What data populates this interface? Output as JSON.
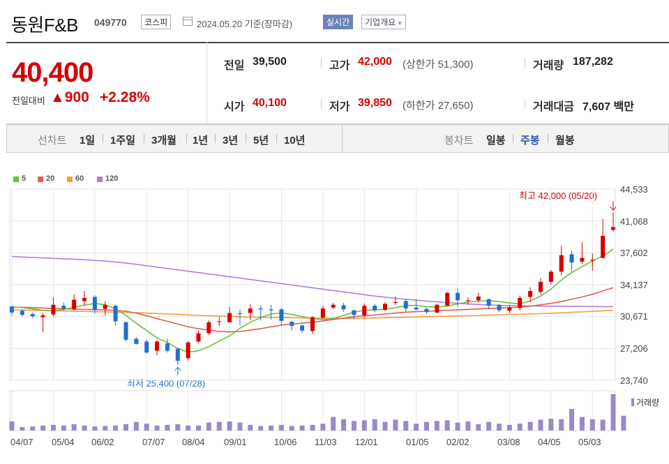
{
  "header": {
    "company": "동원F&B",
    "code": "049770",
    "market": "코스피",
    "date": "2024.05.20  기준(장마감)",
    "realtime": "실시간",
    "overview": "기업개요"
  },
  "quote": {
    "price": "40,400",
    "change_label": "전일대비",
    "change_value": "▲900",
    "change_pct": "+2.28%",
    "prev_label": "전일",
    "prev": "39,500",
    "open_label": "시가",
    "open": "40,100",
    "high_label": "고가",
    "high": "42,000",
    "upper_limit": "(상한가 51,300)",
    "low_label": "저가",
    "low": "39,850",
    "lower_limit": "(하한가 27,650)",
    "volume_label": "거래량",
    "volume": "187,282",
    "amount_label": "거래대금",
    "amount": "7,607 백만"
  },
  "tabs": {
    "line_header": "선차트",
    "line": [
      "1일",
      "1주일",
      "3개월",
      "1년",
      "3년",
      "5년",
      "10년"
    ],
    "candle_header": "봉차트",
    "candle": [
      "일봉",
      "주봉",
      "월봉"
    ],
    "selected": "주봉"
  },
  "colors": {
    "up": "#d60000",
    "down": "#1f6fd1",
    "ma5": "#6bbf3a",
    "ma20": "#e85a4f",
    "ma60": "#f39c3c",
    "ma120": "#b07fd6",
    "volume": "#9b88c9",
    "grid": "#e6e6e6"
  },
  "chart_data": {
    "type": "candlestick",
    "legend": [
      {
        "name": "5",
        "color": "#6bbf3a"
      },
      {
        "name": "20",
        "color": "#e85a4f"
      },
      {
        "name": "60",
        "color": "#f39c3c"
      },
      {
        "name": "120",
        "color": "#b07fd6"
      }
    ],
    "y_ticks": [
      "44,533",
      "41,068",
      "37,602",
      "34,137",
      "30,671",
      "27,206",
      "23,740"
    ],
    "ylim": [
      23740,
      44533
    ],
    "x_ticks": [
      "04/07",
      "05/04",
      "06/02",
      "07/07",
      "08/04",
      "09/01",
      "10/06",
      "11/03",
      "12/01",
      "01/05",
      "02/02",
      "03/08",
      "04/05",
      "05/03"
    ],
    "x_tick_index": [
      0,
      4,
      8,
      13,
      17,
      21,
      26,
      30,
      34,
      39,
      43,
      48,
      52,
      56
    ],
    "annotations": {
      "max": "최고 42,000 (05/20)",
      "min": "최저 25,400 (07/28)"
    },
    "volume_label": "거래량",
    "candles": [
      [
        31750,
        31100,
        31900,
        30800
      ],
      [
        31300,
        30850,
        31450,
        30700
      ],
      [
        30950,
        30700,
        31100,
        30500
      ],
      [
        30600,
        30800,
        31050,
        28950
      ],
      [
        30900,
        31950,
        32750,
        30700
      ],
      [
        31850,
        31500,
        32200,
        31300
      ],
      [
        31450,
        32500,
        33100,
        31300
      ],
      [
        32350,
        32700,
        33450,
        31850
      ],
      [
        32800,
        31400,
        33000,
        31000
      ],
      [
        31500,
        31950,
        32350,
        30750
      ],
      [
        31850,
        30150,
        31950,
        29650
      ],
      [
        30050,
        28150,
        30150,
        27950
      ],
      [
        28250,
        27700,
        28450,
        27600
      ],
      [
        27950,
        26750,
        28150,
        26650
      ],
      [
        26950,
        27950,
        28150,
        26450
      ],
      [
        27750,
        26950,
        28250,
        26750
      ],
      [
        27150,
        25850,
        27300,
        25400
      ],
      [
        26150,
        27850,
        28000,
        25900
      ],
      [
        27950,
        28850,
        29150,
        27800
      ],
      [
        28850,
        30050,
        30250,
        28650
      ],
      [
        30150,
        30150,
        30650,
        29650
      ],
      [
        30050,
        31050,
        31750,
        30750
      ],
      [
        31050,
        30950,
        31450,
        29750
      ],
      [
        31050,
        31550,
        32050,
        30250
      ],
      [
        31550,
        31450,
        31850,
        30250
      ],
      [
        31450,
        31350,
        31950,
        30350
      ],
      [
        31450,
        30200,
        31600,
        29800
      ],
      [
        30100,
        29650,
        30200,
        29150
      ],
      [
        29700,
        29150,
        29800,
        28900
      ],
      [
        29100,
        30600,
        30700,
        28800
      ],
      [
        30550,
        31550,
        31850,
        30450
      ],
      [
        31650,
        31950,
        32150,
        31450
      ],
      [
        31900,
        31450,
        32150,
        31150
      ],
      [
        31350,
        30850,
        31400,
        30350
      ],
      [
        30800,
        31850,
        32100,
        30550
      ],
      [
        31850,
        31350,
        32050,
        31100
      ],
      [
        31400,
        32050,
        32250,
        31250
      ],
      [
        32150,
        32250,
        32850,
        31950
      ],
      [
        32350,
        31550,
        32550,
        31150
      ],
      [
        31650,
        31450,
        32550,
        31350
      ],
      [
        31500,
        31150,
        31650,
        30950
      ],
      [
        31100,
        31950,
        32050,
        31050
      ],
      [
        31850,
        33250,
        33350,
        31850
      ],
      [
        33250,
        32450,
        33750,
        31750
      ],
      [
        32450,
        32450,
        32750,
        31950
      ],
      [
        32450,
        32850,
        33250,
        32200
      ],
      [
        32550,
        31850,
        32650,
        31450
      ],
      [
        31950,
        31350,
        32050,
        31150
      ],
      [
        31300,
        31650,
        31950,
        31050
      ],
      [
        31600,
        32700,
        32950,
        31350
      ],
      [
        32800,
        33450,
        33850,
        32250
      ],
      [
        33350,
        34450,
        34850,
        33050
      ],
      [
        34450,
        35550,
        35750,
        34150
      ],
      [
        35550,
        37350,
        38350,
        35150
      ],
      [
        37450,
        36550,
        37850,
        35550
      ],
      [
        36650,
        37050,
        38750,
        36350
      ],
      [
        36750,
        36850,
        37550,
        35650
      ],
      [
        37050,
        39450,
        41300,
        37000
      ],
      [
        40100,
        40400,
        42000,
        39850
      ]
    ],
    "ma5": [
      31700,
      31650,
      31500,
      31350,
      31300,
      31450,
      31700,
      31900,
      32100,
      31950,
      31500,
      30800,
      29950,
      29150,
      28350,
      27850,
      27200,
      26800,
      26950,
      27400,
      28000,
      28550,
      29400,
      30050,
      30550,
      30950,
      31050,
      30900,
      30650,
      30450,
      30350,
      30450,
      30800,
      31150,
      31350,
      31400,
      31450,
      31650,
      31850,
      31900,
      31750,
      31700,
      31800,
      32050,
      32250,
      32350,
      32400,
      32300,
      32150,
      32050,
      32350,
      32900,
      33650,
      34650,
      35450,
      36100,
      36700,
      37250,
      38000
    ],
    "ma20": [
      31700,
      31680,
      31650,
      31600,
      31550,
      31500,
      31480,
      31450,
      31420,
      31380,
      31350,
      31250,
      31050,
      30750,
      30450,
      30150,
      29850,
      29550,
      29350,
      29200,
      29050,
      29000,
      29050,
      29200,
      29350,
      29550,
      29750,
      29850,
      29950,
      30050,
      30200,
      30350,
      30500,
      30650,
      30750,
      30850,
      30950,
      31050,
      31150,
      31200,
      31250,
      31300,
      31350,
      31400,
      31450,
      31500,
      31550,
      31600,
      31650,
      31700,
      31800,
      31950,
      32100,
      32300,
      32550,
      32800,
      33100,
      33450,
      33800
    ],
    "ma60": [
      31400,
      31380,
      31350,
      31330,
      31300,
      31280,
      31250,
      31230,
      31200,
      31180,
      31150,
      31120,
      31090,
      31050,
      31000,
      30950,
      30900,
      30850,
      30800,
      30760,
      30720,
      30680,
      30650,
      30620,
      30600,
      30580,
      30560,
      30540,
      30520,
      30500,
      30490,
      30480,
      30480,
      30490,
      30500,
      30520,
      30540,
      30560,
      30590,
      30620,
      30650,
      30680,
      30710,
      30740,
      30770,
      30800,
      30830,
      30860,
      30890,
      30920,
      30950,
      30990,
      31030,
      31080,
      31130,
      31180,
      31230,
      31280,
      31350
    ],
    "ma120": [
      37200,
      37150,
      37100,
      37050,
      37000,
      36950,
      36900,
      36850,
      36780,
      36700,
      36600,
      36480,
      36350,
      36200,
      36050,
      35900,
      35750,
      35600,
      35450,
      35300,
      35150,
      35000,
      34850,
      34700,
      34550,
      34400,
      34250,
      34100,
      33950,
      33800,
      33650,
      33500,
      33350,
      33200,
      33050,
      32900,
      32780,
      32660,
      32550,
      32450,
      32350,
      32270,
      32190,
      32110,
      32040,
      31980,
      31930,
      31890,
      31860,
      31840,
      31820,
      31810,
      31800,
      31790,
      31780,
      31770,
      31760,
      31755,
      31750
    ],
    "volume": [
      40,
      15,
      18,
      22,
      25,
      22,
      28,
      22,
      18,
      20,
      22,
      28,
      38,
      30,
      22,
      25,
      28,
      22,
      22,
      35,
      38,
      40,
      35,
      25,
      20,
      22,
      25,
      20,
      22,
      25,
      30,
      60,
      50,
      42,
      45,
      50,
      38,
      48,
      42,
      30,
      38,
      42,
      45,
      35,
      40,
      28,
      38,
      30,
      25,
      30,
      38,
      48,
      52,
      50,
      95,
      60,
      50,
      48,
      160,
      65
    ]
  }
}
